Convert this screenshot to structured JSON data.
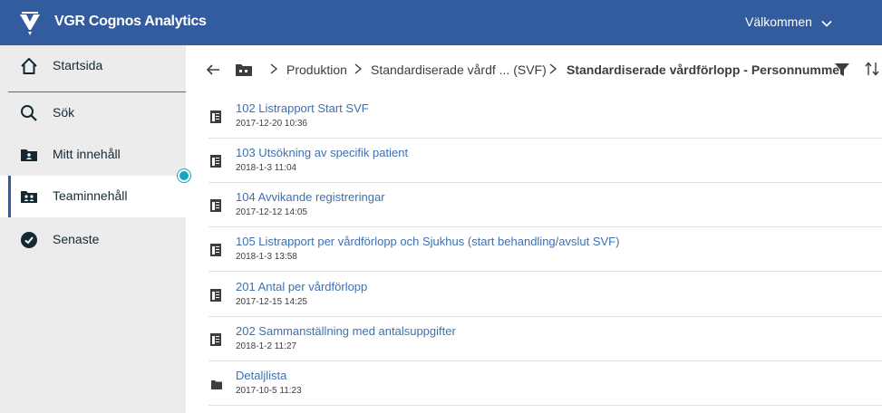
{
  "header": {
    "app_title": "VGR Cognos Analytics",
    "welcome_label": "Välkommen",
    "brand_color": "#325c9e"
  },
  "sidebar": {
    "items": [
      {
        "label": "Startsida",
        "icon": "home-icon"
      },
      {
        "label": "Sök",
        "icon": "search-icon"
      },
      {
        "label": "Mitt innehåll",
        "icon": "my-content-folder-icon"
      },
      {
        "label": "Teaminnehåll",
        "icon": "team-content-folder-icon",
        "active": true
      },
      {
        "label": "Senaste",
        "icon": "recent-icon"
      }
    ]
  },
  "breadcrumb": {
    "items": [
      "Produktion",
      "Standardiserade vårdf ... (SVF)"
    ],
    "current": "Standardiserade vårdförlopp - Personnummer"
  },
  "content": {
    "rows": [
      {
        "title": "102 Listrapport Start SVF",
        "date": "2017-12-20 10:36",
        "type": "report"
      },
      {
        "title": "103 Utsökning av specifik patient",
        "date": "2018-1-3 11:04",
        "type": "report"
      },
      {
        "title": "104 Avvikande registreringar",
        "date": "2017-12-12 14:05",
        "type": "report"
      },
      {
        "title": "105 Listrapport per vårdförlopp och Sjukhus (start behandling/avslut SVF)",
        "date": "2018-1-3 13:58",
        "type": "report"
      },
      {
        "title": "201 Antal per vårdförlopp",
        "date": "2017-12-15 14:25",
        "type": "report"
      },
      {
        "title": "202 Sammanställning med antalsuppgifter",
        "date": "2018-1-2 11:27",
        "type": "report"
      },
      {
        "title": "Detaljlista",
        "date": "2017-10-5 11:23",
        "type": "folder"
      }
    ]
  }
}
